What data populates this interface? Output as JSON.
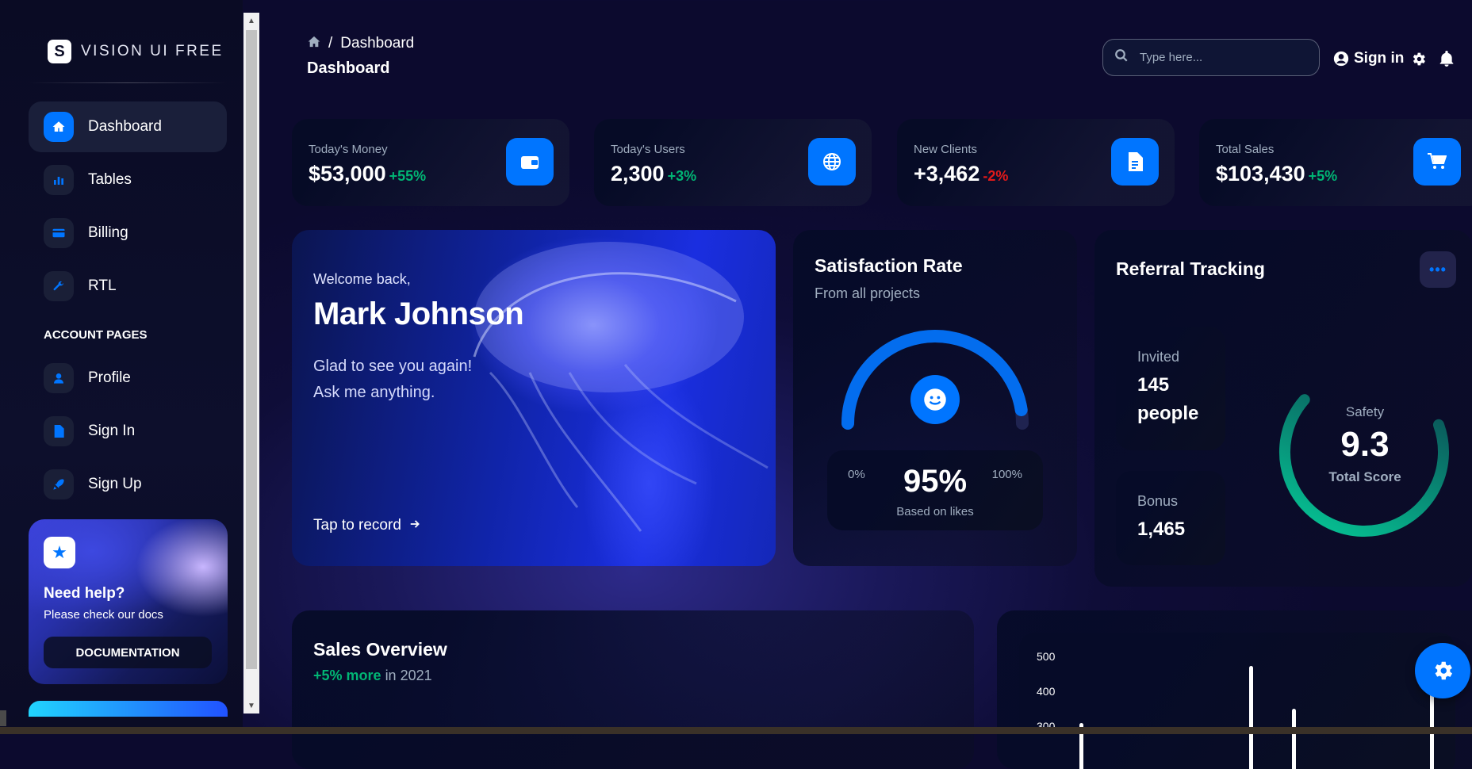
{
  "brand": {
    "logo_letter": "S",
    "name": "VISION UI FREE"
  },
  "sidebar": {
    "items": [
      {
        "label": "Dashboard",
        "icon": "home-icon",
        "active": true
      },
      {
        "label": "Tables",
        "icon": "bar-chart-icon"
      },
      {
        "label": "Billing",
        "icon": "credit-card-icon"
      },
      {
        "label": "RTL",
        "icon": "wrench-icon"
      }
    ],
    "section_title": "ACCOUNT PAGES",
    "account_items": [
      {
        "label": "Profile",
        "icon": "person-icon"
      },
      {
        "label": "Sign In",
        "icon": "document-icon"
      },
      {
        "label": "Sign Up",
        "icon": "rocket-icon"
      }
    ],
    "help": {
      "title": "Need help?",
      "subtitle": "Please check our docs",
      "button": "DOCUMENTATION"
    }
  },
  "header": {
    "breadcrumb": {
      "current": "Dashboard",
      "separator": "/"
    },
    "title": "Dashboard",
    "search_placeholder": "Type here...",
    "signin_label": "Sign in"
  },
  "stats": [
    {
      "label": "Today's Money",
      "value": "$53,000",
      "delta": "+55%",
      "positive": true,
      "icon": "wallet-icon"
    },
    {
      "label": "Today's Users",
      "value": "2,300",
      "delta": "+3%",
      "positive": true,
      "icon": "globe-icon"
    },
    {
      "label": "New Clients",
      "value": "+3,462",
      "delta": "-2%",
      "positive": false,
      "icon": "document-icon"
    },
    {
      "label": "Total Sales",
      "value": "$103,430",
      "delta": "+5%",
      "positive": true,
      "icon": "cart-icon"
    }
  ],
  "welcome": {
    "greeting": "Welcome back,",
    "name": "Mark Johnson",
    "line1": "Glad to see you again!",
    "line2": "Ask me anything.",
    "cta": "Tap to record"
  },
  "satisfaction": {
    "title": "Satisfaction Rate",
    "subtitle": "From all projects",
    "min": "0%",
    "max": "100%",
    "value": "95%",
    "value_fraction": 0.95,
    "caption": "Based on likes"
  },
  "referral": {
    "title": "Referral Tracking",
    "invited_label": "Invited",
    "invited_value_line1": "145",
    "invited_value_line2": "people",
    "bonus_label": "Bonus",
    "bonus_value": "1,465",
    "safety_label": "Safety",
    "score": "9.3",
    "score_label": "Total Score",
    "score_fraction": 0.93
  },
  "sales": {
    "title": "Sales Overview",
    "highlight": "+5% more",
    "suffix": "in 2021"
  },
  "bars_chart": {
    "ticks": [
      "500",
      "400",
      "300"
    ]
  },
  "colors": {
    "accent": "#0075ff",
    "positive": "#01b574",
    "negative": "#e31a1a",
    "teal": "#05cd99"
  }
}
